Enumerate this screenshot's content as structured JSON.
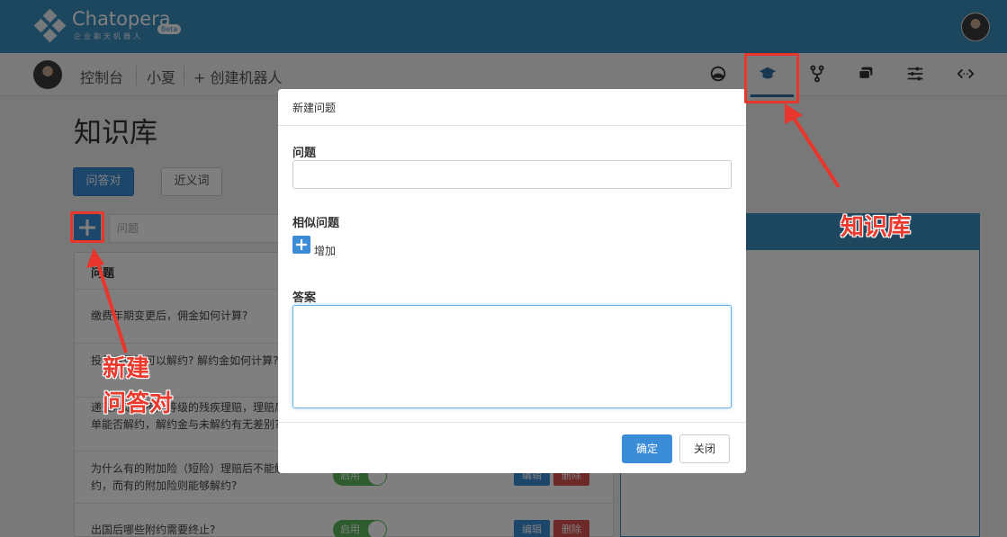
{
  "brand": {
    "name": "Chatopera",
    "subtitle": "企业聊天机器人",
    "badge": "Beta"
  },
  "nav": {
    "console": "控制台",
    "bot_name": "小夏",
    "create_bot": "+ 创建机器人",
    "icons": [
      "dashboard-icon",
      "knowledge-base-icon",
      "fork-icon",
      "chat-icon",
      "sliders-icon",
      "code-icon"
    ],
    "active_icon": "knowledge-base-icon"
  },
  "page": {
    "title": "知识库",
    "tabs": [
      "问答对",
      "近义词"
    ],
    "search_placeholder": "问题",
    "table_header": "问题",
    "rows": [
      {
        "question": "缴费年期变更后，佣金如何计算?"
      },
      {
        "question": "投保后是否可以解约? 解约金如何计算?"
      },
      {
        "question": "递交规定有不同等级的残疾理赔，理赔后保单能否解约，解约金与未解约有无差别?"
      },
      {
        "question": "为什么有的附加险（短险）理赔后不能解约，而有的附加险则能够解约?",
        "status": "启用",
        "edit": "编辑",
        "delete": "删除"
      },
      {
        "question": "出国后哪些附约需要终止?",
        "status": "启用",
        "edit": "编辑",
        "delete": "删除"
      }
    ]
  },
  "modal": {
    "title": "新建问题",
    "question_label": "问题",
    "question_value": "",
    "similar_label": "相似问题",
    "add_label": "增加",
    "answer_label": "答案",
    "answer_value": "",
    "confirm": "确定",
    "close": "关闭"
  },
  "annotations": {
    "new_qa_line1": "新建",
    "new_qa_line2": "问答对",
    "kb_label": "知识库",
    "color": "#e8362d"
  }
}
